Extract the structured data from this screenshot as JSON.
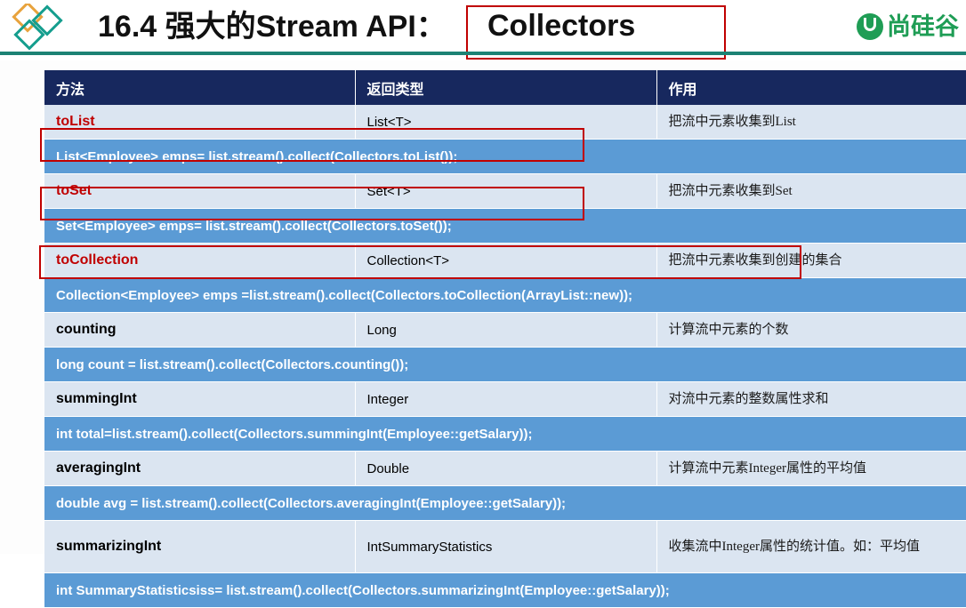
{
  "header": {
    "title": "16.4 强大的Stream API：",
    "subject": "Collectors",
    "left_logo_name": "diamond-logo",
    "right_logo_text": "尚硅谷",
    "accent_green": "#1f9d55",
    "rule_color": "#1d8274",
    "highlight_color": "#c00000"
  },
  "table": {
    "columns": [
      "方法",
      "返回类型",
      "作用"
    ],
    "header_bg": "#17285e",
    "method_row_bg": "#dbe5f1",
    "code_row_bg": "#5b9bd5",
    "rows": [
      {
        "method": "toList",
        "method_color": "#c00000",
        "return_type": "List<T>",
        "description": "把流中元素收集到List",
        "code": "List<Employee> emps= list.stream().collect(Collectors.toList());",
        "code_highlighted": true
      },
      {
        "method": "toSet",
        "method_color": "#c00000",
        "return_type": "Set<T>",
        "description": "把流中元素收集到Set",
        "code": "Set<Employee> emps= list.stream().collect(Collectors.toSet());",
        "code_highlighted": true
      },
      {
        "method": "toCollection",
        "method_color": "#c00000",
        "return_type": "Collection<T>",
        "description": "把流中元素收集到创建的集合",
        "code": "Collection<Employee> emps =list.stream().collect(Collectors.toCollection(ArrayList::new));",
        "code_highlighted": true
      },
      {
        "method": "counting",
        "method_color": "#000000",
        "return_type": "Long",
        "description": "计算流中元素的个数",
        "code": "long count = list.stream().collect(Collectors.counting());",
        "code_highlighted": false
      },
      {
        "method": "summingInt",
        "method_color": "#000000",
        "return_type": "Integer",
        "description": "对流中元素的整数属性求和",
        "code": "int total=list.stream().collect(Collectors.summingInt(Employee::getSalary));",
        "code_highlighted": false
      },
      {
        "method": "averagingInt",
        "method_color": "#000000",
        "return_type": "Double",
        "description": "计算流中元素Integer属性的平均值",
        "code": "double avg = list.stream().collect(Collectors.averagingInt(Employee::getSalary));",
        "code_highlighted": false
      },
      {
        "method": "summarizingInt",
        "method_color": "#000000",
        "return_type": "IntSummaryStatistics",
        "description": "收集流中Integer属性的统计值。如：平均值",
        "code": "int SummaryStatisticsiss= list.stream().collect(Collectors.summarizingInt(Employee::getSalary));",
        "code_highlighted": false
      }
    ]
  }
}
